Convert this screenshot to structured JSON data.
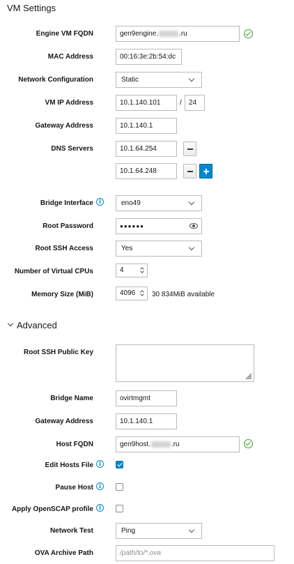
{
  "vm_settings": {
    "title": "VM Settings",
    "engine_fqdn": {
      "label": "Engine VM FQDN",
      "prefix": "gen9engine.",
      "suffix": ".ru"
    },
    "mac": {
      "label": "MAC Address",
      "value": "00:16:3e:2b:54:dc"
    },
    "network_config": {
      "label": "Network Configuration",
      "value": "Static"
    },
    "vm_ip": {
      "label": "VM IP Address",
      "value": "10.1.140.101",
      "separator": "/",
      "prefix_len": "24"
    },
    "gateway": {
      "label": "Gateway Address",
      "value": "10.1.140.1"
    },
    "dns": {
      "label": "DNS Servers",
      "servers": [
        "10.1.64.254",
        "10.1.64.248"
      ]
    },
    "bridge_interface": {
      "label": "Bridge Interface",
      "value": "eno49"
    },
    "root_password": {
      "label": "Root Password",
      "value": "●●●●●●"
    },
    "root_ssh": {
      "label": "Root SSH Access",
      "value": "Yes"
    },
    "vcpus": {
      "label": "Number of Virtual CPUs",
      "value": "4"
    },
    "memory": {
      "label": "Memory Size (MiB)",
      "value": "4096",
      "available": "30 834MiB available"
    }
  },
  "advanced": {
    "title": "Advanced",
    "ssh_key": {
      "label": "Root SSH Public Key",
      "value": ""
    },
    "bridge_name": {
      "label": "Bridge Name",
      "value": "ovirtmgmt"
    },
    "gateway": {
      "label": "Gateway Address",
      "value": "10.1.140.1"
    },
    "host_fqdn": {
      "label": "Host FQDN",
      "prefix": "gen9host.",
      "suffix": ".ru"
    },
    "edit_hosts": {
      "label": "Edit Hosts File",
      "checked": true
    },
    "pause_host": {
      "label": "Pause Host",
      "checked": false
    },
    "openscap": {
      "label": "Apply OpenSCAP profile",
      "checked": false
    },
    "network_test": {
      "label": "Network Test",
      "value": "Ping"
    },
    "ova_path": {
      "label": "OVA Archive Path",
      "placeholder": "/path/to/*.ova"
    }
  },
  "icons": {
    "valid": "check-circle-icon",
    "info": "info-circle-icon",
    "eye": "eye-icon",
    "chevron": "chevron-down-icon"
  },
  "colors": {
    "accent": "#0088ce",
    "success": "#3f9c35",
    "border": "#bbbbbb"
  }
}
